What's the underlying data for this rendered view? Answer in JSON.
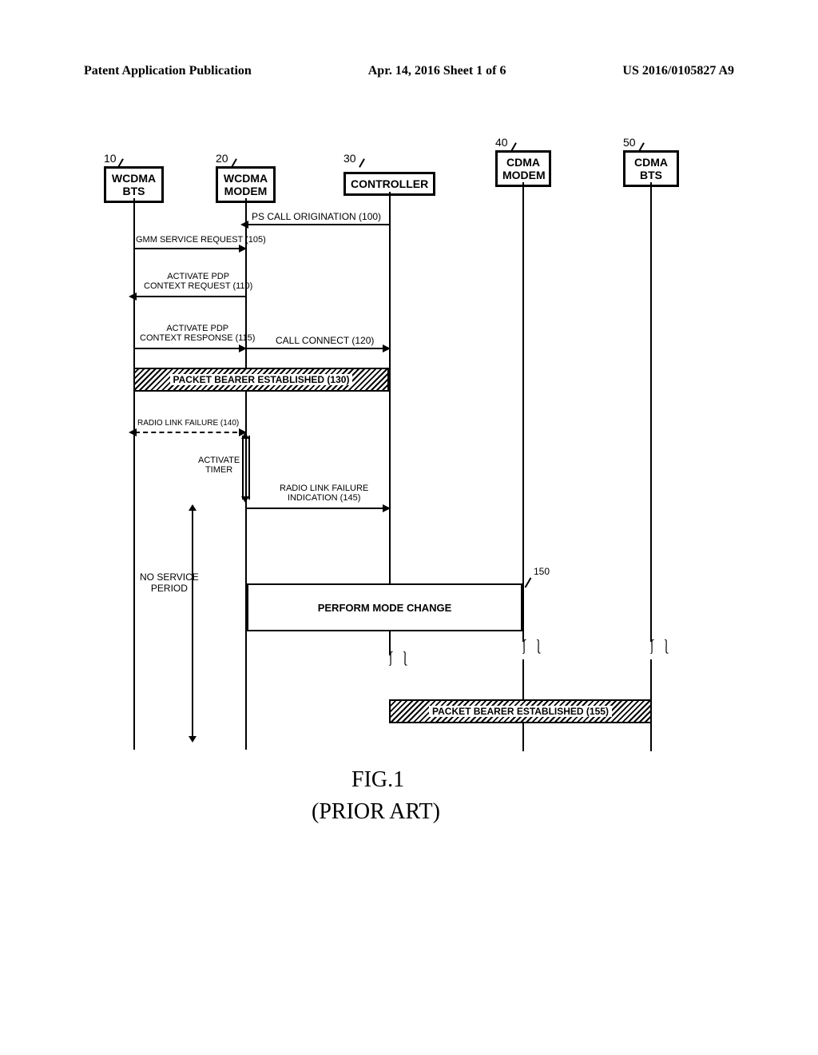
{
  "header": {
    "left": "Patent Application Publication",
    "center": "Apr. 14, 2016  Sheet 1 of 6",
    "right": "US 2016/0105827 A9"
  },
  "actors": {
    "wcdma_bts": {
      "id": "10",
      "name": "WCDMA\nBTS"
    },
    "wcdma_modem": {
      "id": "20",
      "name": "WCDMA\nMODEM"
    },
    "controller": {
      "id": "30",
      "name": "CONTROLLER"
    },
    "cdma_modem": {
      "id": "40",
      "name": "CDMA\nMODEM"
    },
    "cdma_bts": {
      "id": "50",
      "name": "CDMA\nBTS"
    }
  },
  "messages": {
    "ps_call": "PS CALL ORIGINATION (100)",
    "gmm_service": "GMM SERVICE REQUEST (105)",
    "activate_pdp_req_line1": "ACTIVATE PDP",
    "activate_pdp_req_line2": "CONTEXT REQUEST (110)",
    "activate_pdp_resp_line1": "ACTIVATE PDP",
    "activate_pdp_resp_line2": "CONTEXT RESPONSE (115)",
    "call_connect": "CALL CONNECT (120)",
    "packet_bearer_1": "PACKET BEARER ESTABLISHED (130)",
    "radio_link_failure": "RADIO LINK FAILURE (140)",
    "activate_timer_line1": "ACTIVATE",
    "activate_timer_line2": "TIMER",
    "radio_link_failure_ind_line1": "RADIO LINK FAILURE",
    "radio_link_failure_ind_line2": "INDICATION (145)",
    "no_service_line1": "NO SERVICE",
    "no_service_line2": "PERIOD",
    "mode_change": "PERFORM MODE CHANGE",
    "mode_change_id": "150",
    "packet_bearer_2": "PACKET BEARER ESTABLISHED (155)"
  },
  "figure": {
    "caption": "FIG.1",
    "note": "(PRIOR ART)"
  }
}
